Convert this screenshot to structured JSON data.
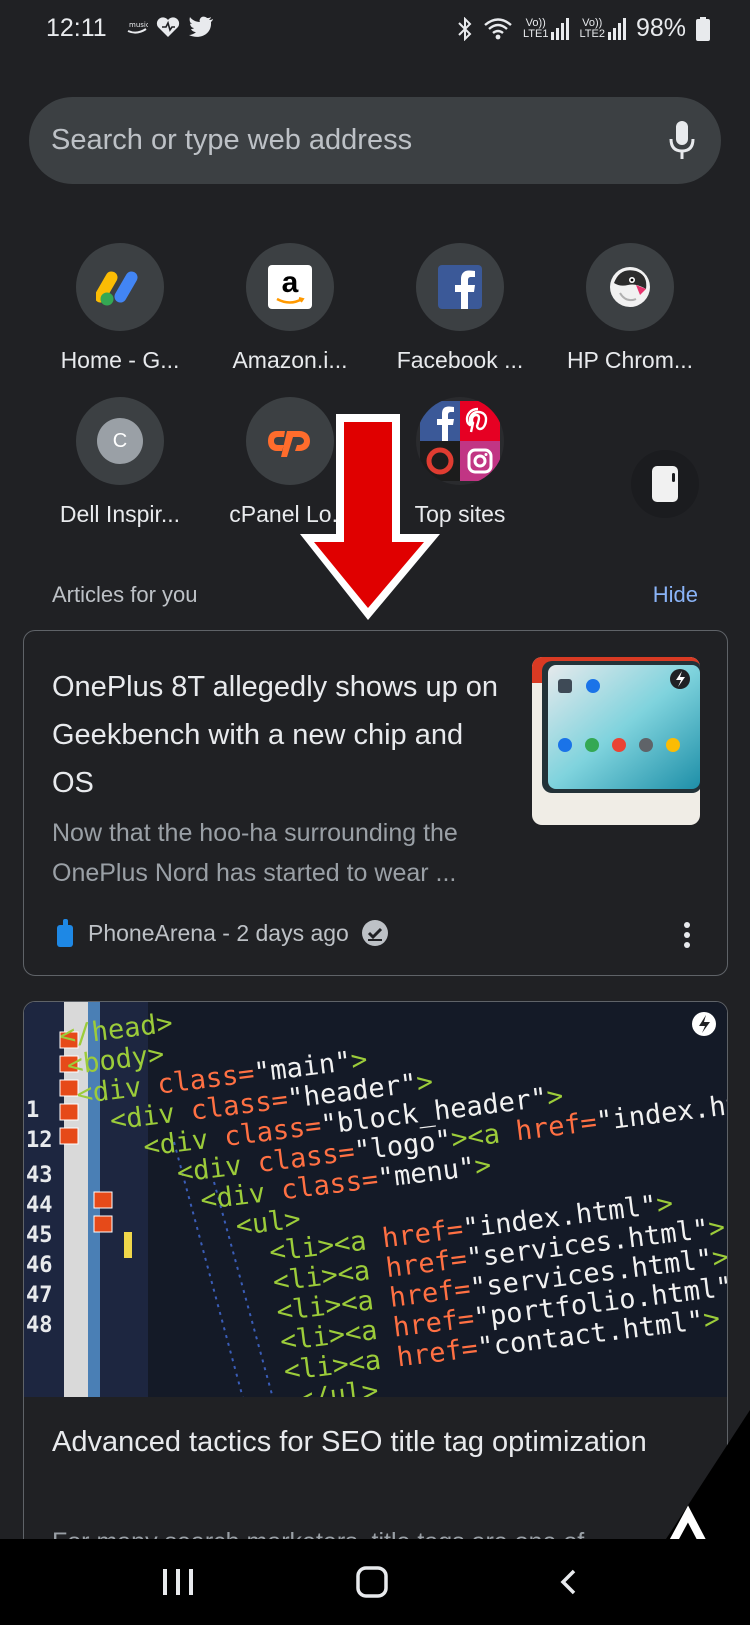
{
  "status_bar": {
    "time": "12:11",
    "left_icons": [
      "music-icon",
      "heart-icon",
      "twitter-icon"
    ],
    "right_icons": [
      "bluetooth-icon",
      "wifi-icon",
      "signal-lte1-icon",
      "signal-lte2-icon"
    ],
    "sim1_label": "LTE1",
    "sim2_label": "LTE2",
    "volte_label": "Vo))",
    "battery": "98%"
  },
  "search": {
    "placeholder": "Search or type web address",
    "icon": "microphone-icon"
  },
  "shortcuts": [
    {
      "label": "Home - G...",
      "icon": "google-ads-icon"
    },
    {
      "label": "Amazon.i...",
      "icon": "amazon-icon"
    },
    {
      "label": "Facebook ...",
      "icon": "facebook-icon"
    },
    {
      "label": "HP Chrom...",
      "icon": "hp-puffin-icon"
    },
    {
      "label": "Dell Inspir...",
      "icon": "letter-c-icon",
      "letter": "C"
    },
    {
      "label": "cPanel Lo...",
      "icon": "cpanel-icon"
    },
    {
      "label": "Top sites",
      "icon": "top-sites-icon"
    }
  ],
  "articles": {
    "header": "Articles for you",
    "hide_label": "Hide",
    "items": [
      {
        "title": "OnePlus 8T allegedly shows up on Geekbench with a new chip and OS",
        "snippet": "Now that the hoo-ha surrounding the OnePlus Nord has started to wear ...",
        "source": "PhoneArena - 2 days ago"
      },
      {
        "title": "Advanced tactics for SEO title tag optimization",
        "snippet": "For many search marketers, title tags are one of"
      }
    ]
  },
  "code_image": {
    "line_numbers": [
      "1",
      "12",
      "43",
      "44",
      "45",
      "46",
      "47",
      "48"
    ],
    "lines": [
      "</head>",
      "<body>",
      "<div class=\"main\">",
      "<div class=\"header\">",
      "<div class=\"block_header\">",
      "<div class=\"logo\"><a href=\"index.html\">",
      "<div class=\"menu\">",
      "<ul>",
      "<li><a href=\"index.html\">",
      "<li><a href=\"services.html\">",
      "<li><a href=\"services.html\">",
      "<li><a href=\"portfolio.html\">",
      "<li><a href=\"contact.html\">",
      "</ul>"
    ]
  },
  "nav": {
    "recents": "recents-icon",
    "home": "home-icon",
    "back": "back-icon"
  },
  "colors": {
    "background": "#202124",
    "surface": "#3c4043",
    "accent": "#8ab4f8",
    "arrow": "#e00000"
  }
}
